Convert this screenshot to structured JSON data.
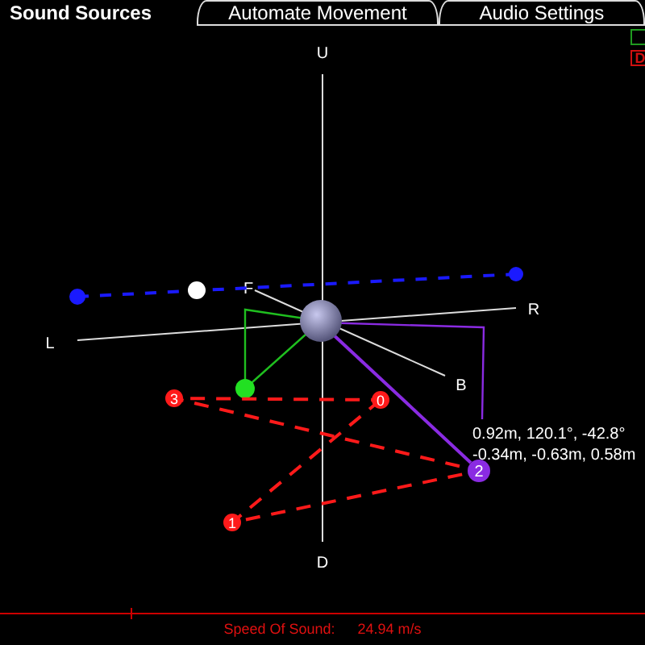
{
  "tabs": [
    {
      "label": "Sound Sources",
      "selected": true
    },
    {
      "label": "Automate Movement",
      "selected": false
    },
    {
      "label": "Audio Settings",
      "selected": false
    }
  ],
  "side_buttons": [
    {
      "kind": "blank",
      "color": "#1f9a1f"
    },
    {
      "kind": "text",
      "label": "D",
      "color": "#d01010"
    }
  ],
  "axes": {
    "up": "U",
    "down": "D",
    "left": "L",
    "right": "R",
    "front": "F",
    "back": "B"
  },
  "waypoints": [
    {
      "label": "0",
      "color": "#ff1a1a",
      "selected": false
    },
    {
      "label": "1",
      "color": "#ff1a1a",
      "selected": false
    },
    {
      "label": "2",
      "color": "#8a2be2",
      "selected": true
    },
    {
      "label": "3",
      "color": "#ff1a1a",
      "selected": false
    }
  ],
  "readout": [
    "0.92m, 120.1°, -42.8°",
    "-0.34m, -0.63m, 0.58m"
  ],
  "status": {
    "label": "Speed Of Sound:",
    "value": "24.94 m/s"
  }
}
